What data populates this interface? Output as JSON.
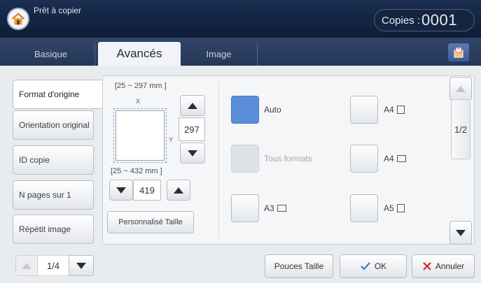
{
  "header": {
    "title": "Prêt à copier",
    "copies_label": "Copies :",
    "copies_value": "0001"
  },
  "tabs": [
    {
      "label": "Basique",
      "active": false
    },
    {
      "label": "Avancés",
      "active": true
    },
    {
      "label": "Image",
      "active": false
    }
  ],
  "sidebar": {
    "items": [
      {
        "label": "Format d'origine",
        "active": true
      },
      {
        "label": "Orientation original",
        "active": false
      },
      {
        "label": "ID copie",
        "active": false
      },
      {
        "label": "N pages sur 1",
        "active": false
      },
      {
        "label": "Répétit image",
        "active": false
      }
    ]
  },
  "custom_size": {
    "x_range": "[25 ~ 297 mm ]",
    "y_range": "[25 ~ 432 mm ]",
    "x_axis": "X",
    "y_axis": "Y",
    "y_value": "297",
    "x_value": "419",
    "custom_button": "Personnalisé Taille"
  },
  "options": [
    {
      "label": "Auto",
      "state": "selected"
    },
    {
      "label": "A4",
      "icon": "portrait-page-icon",
      "state": "normal"
    },
    {
      "label": "Tous formats",
      "state": "disabled"
    },
    {
      "label": "A4",
      "icon": "landscape-page-icon",
      "state": "normal"
    },
    {
      "label": "A3",
      "icon": "landscape-page-icon",
      "state": "normal"
    },
    {
      "label": "A5",
      "icon": "portrait-page-icon",
      "state": "normal"
    }
  ],
  "scroll": {
    "page": "1/2"
  },
  "footer": {
    "pager": "1/4",
    "inches_button": "Pouces Taille",
    "ok_button": "OK",
    "cancel_button": "Annuler"
  },
  "colors": {
    "header_bg": "#0e1c36",
    "selected": "#5b8ed8",
    "ok_check": "#3a78d8",
    "cancel_x": "#d8252a"
  }
}
